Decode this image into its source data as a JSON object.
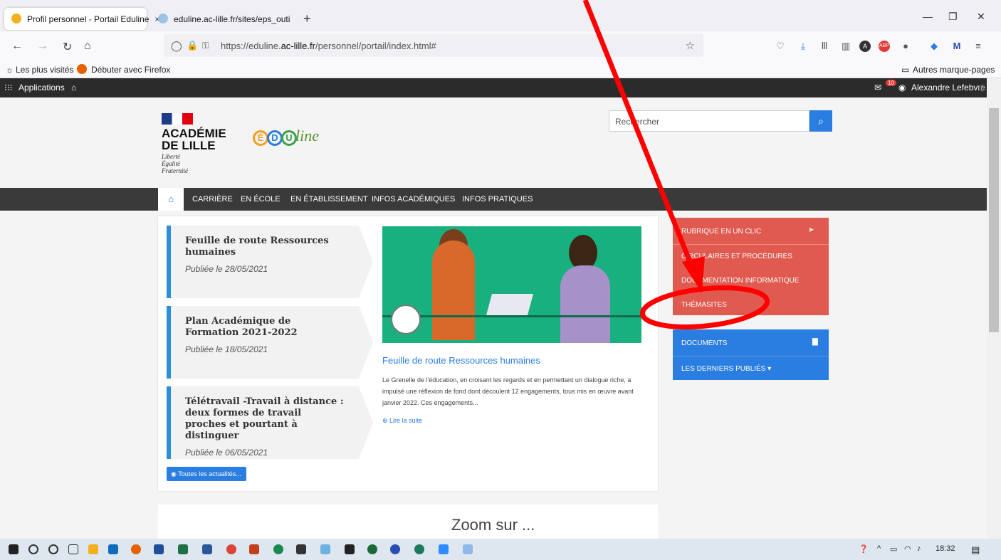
{
  "browser": {
    "tabs": [
      {
        "label": "Profil personnel - Portail Eduline",
        "close": "×"
      },
      {
        "label": "eduline.ac-lille.fr/sites/eps_outi",
        "close": "×"
      }
    ],
    "new_tab": "+",
    "url_prefix": "https://eduline.",
    "url_domain": "ac-lille.fr",
    "url_suffix": "/personnel/portail/index.html#",
    "bookmarks": [
      "Les plus visités",
      "Débuter avec Firefox"
    ],
    "other_bookmarks": "Autres marque-pages"
  },
  "portal_bar": {
    "apps": "Applications",
    "mail_count": "10",
    "user": "Alexandre Lefebvre"
  },
  "header": {
    "logo_line1": "ACADÉMIE",
    "logo_line2": "DE LILLE",
    "motto": [
      "Liberté",
      "Égalité",
      "Fraternité"
    ],
    "search_placeholder": "Rechercher"
  },
  "nav": [
    "CARRIÈRE",
    "EN ÉCOLE",
    "EN ÉTABLISSEMENT",
    "INFOS ACADÉMIQUES",
    "INFOS PRATIQUES"
  ],
  "news": [
    {
      "title": "Feuille de route Ressources humaines",
      "date": "Publiée le 28/05/2021"
    },
    {
      "title": "Plan Académique de Formation 2021-2022",
      "date": "Publiée le 18/05/2021"
    },
    {
      "title": "Télétravail -Travail à distance : deux formes de travail proches et pourtant à distinguer",
      "date": "Publiée le 06/05/2021"
    }
  ],
  "all_news": "Toutes les actualités...",
  "featured": {
    "title": "Feuille de route Ressources humaines",
    "text": "Le Grenelle de l'éducation, en croisant les regards et en permettant un dialogue riche, a impulsé une réflexion de fond dont découlent 12 engagements, tous mis en œuvre avant janvier 2022. Ces engagements...",
    "more": "Lire la suite"
  },
  "rubrique": {
    "header": "RUBRIQUE EN UN CLIC",
    "items": [
      "CIRCULAIRES ET PROCÉDURES",
      "DOCUMENTATION INFORMATIQUE",
      "THÉMASITES"
    ]
  },
  "documents": {
    "header": "DOCUMENTS",
    "item": "LES DERNIERS PUBLIÉS"
  },
  "zoom": "Zoom sur ...",
  "taskbar": {
    "time": "18:32"
  },
  "colors": {
    "accent": "#2a7de1",
    "rubrique": "#e05a4f",
    "annotation": "#ff0000"
  }
}
